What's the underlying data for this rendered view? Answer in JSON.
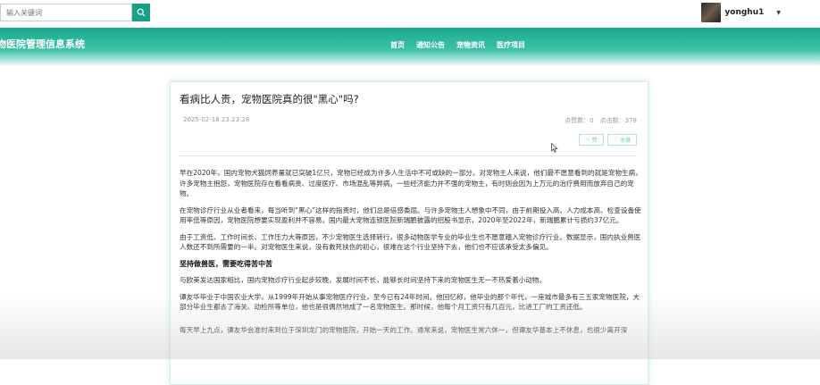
{
  "search": {
    "placeholder": "输入关键词"
  },
  "user": {
    "name": "yonghu1"
  },
  "brand": {
    "title": "物医院管理信息系统"
  },
  "nav": {
    "items": [
      "首页",
      "通知公告",
      "宠物资讯",
      "医疗项目"
    ]
  },
  "article": {
    "title": "看病比人贵，宠物医院真的很\"黑心\"吗?",
    "date": "2025-02-18 23:23:28",
    "stats": "点赞数：0　点击数：378",
    "like_label": "赞",
    "collect_label": "收藏",
    "paragraphs": [
      "早在2020年，国内宠物犬猫饲养量就已突破1亿只，宠物已经成为许多人生活中不可或缺的一部分。对宠物主人来说，他们最不愿意看到的就是宠物生病，许多宠物主抱怨，宠物医院存在看看病贵、过度医疗、市场混乱等弊病。一些经济能力并不强的宠物主，有时则会因为上万元的治疗费用而放弃自己的宠物。",
      "在宠物诊疗行业从业者看来，每当听到“黑心”这样的指责时，他们总是倍感委屈。与许多宠物主人想象中不同，由于前期投入高、人力成本高、检查设备使用率低等原因，宠物医院想要实现盈利并不容易。国内最大宠物连锁医院新瑞鹏披露的招股书显示，2020年至2022年，新瑞鹏累计亏损约37亿元。",
      "由于工资低、工作时间长、工作压力大等原因，不少宠物医生选择转行，很多动物医学专业的毕业生也不愿意踏入宠物诊疗行业。数据显示，国内执业兽医人数还不到所需要的一半。对宠物医生来说，没有救死扶伤的初心，很难在这个行业坚持下去，他们也不应该承受太多偏见。",
      "坚持做兽医，需要吃得苦中苦",
      "与欧美发达国家相比，国内宠物诊疗行业起步较晚，发展时间不长，能够长时间坚持下来的宠物医生无一不热爱着小动物。",
      "谭友华毕业于中国农业大学，从1999年开始从事宠物医疗行业，至今已有24年时间。他回忆称，他毕业的那个年代，一座城市最多有三五家宠物医院，大部分毕业生都去了海关、动检所等单位，他也是很偶然地成了一名宠物医生。那时候，他每个月工资只有几百元，比进工厂的工资还低。",
      "每天早上九点，谭友华会准时来到位于深圳龙门的宠物医院，开始一天的工作。通常来说，宠物医生常六休一，但谭友华基本上不休息，也很少离开深"
    ]
  }
}
